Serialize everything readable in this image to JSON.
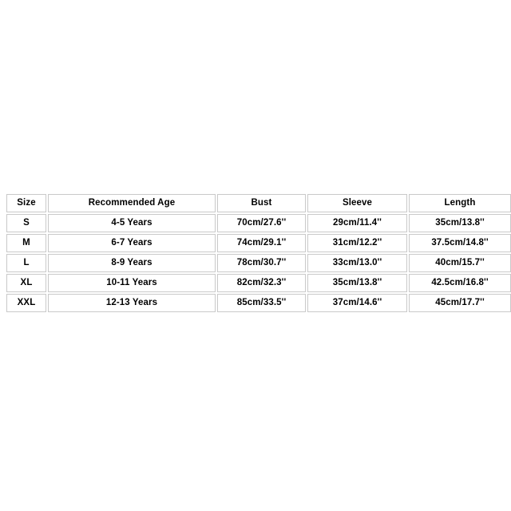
{
  "page": {
    "background_color": "#ffffff",
    "table_border_color": "#c9c9c9",
    "text_color": "#000000"
  },
  "size_chart": {
    "columns": [
      {
        "key": "size",
        "label": "Size"
      },
      {
        "key": "age",
        "label": "Recommended Age"
      },
      {
        "key": "bust",
        "label": "Bust"
      },
      {
        "key": "sleeve",
        "label": "Sleeve"
      },
      {
        "key": "length",
        "label": "Length"
      }
    ],
    "rows": [
      {
        "size": "S",
        "age": "4-5 Years",
        "bust": "70cm/27.6''",
        "sleeve": "29cm/11.4''",
        "length": "35cm/13.8''"
      },
      {
        "size": "M",
        "age": "6-7 Years",
        "bust": "74cm/29.1''",
        "sleeve": "31cm/12.2''",
        "length": "37.5cm/14.8''"
      },
      {
        "size": "L",
        "age": "8-9 Years",
        "bust": "78cm/30.7''",
        "sleeve": "33cm/13.0''",
        "length": "40cm/15.7''"
      },
      {
        "size": "XL",
        "age": "10-11 Years",
        "bust": "82cm/32.3''",
        "sleeve": "35cm/13.8''",
        "length": "42.5cm/16.8''"
      },
      {
        "size": "XXL",
        "age": "12-13 Years",
        "bust": "85cm/33.5''",
        "sleeve": "37cm/14.6''",
        "length": "45cm/17.7''"
      }
    ]
  }
}
